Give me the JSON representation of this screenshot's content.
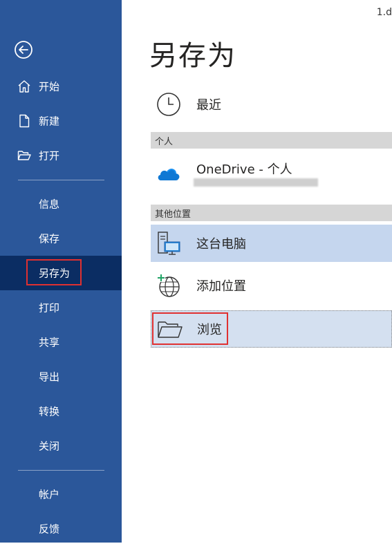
{
  "document": {
    "filename": "1.d"
  },
  "sidebar": {
    "back_icon": "back-arrow-icon",
    "top_items": [
      {
        "label": "开始",
        "icon": "home-icon"
      },
      {
        "label": "新建",
        "icon": "new-document-icon"
      },
      {
        "label": "打开",
        "icon": "open-folder-icon"
      }
    ],
    "middle_items": [
      {
        "label": "信息"
      },
      {
        "label": "保存"
      },
      {
        "label": "另存为",
        "selected": true
      },
      {
        "label": "打印"
      },
      {
        "label": "共享"
      },
      {
        "label": "导出"
      },
      {
        "label": "转换"
      },
      {
        "label": "关闭"
      }
    ],
    "bottom_items": [
      {
        "label": "帐户"
      },
      {
        "label": "反馈"
      }
    ]
  },
  "main": {
    "title": "另存为",
    "recent": {
      "label": "最近",
      "icon": "clock-icon"
    },
    "personal_header": "个人",
    "onedrive": {
      "label": "OneDrive - 个人",
      "icon": "onedrive-cloud-icon"
    },
    "other_header": "其他位置",
    "this_pc": {
      "label": "这台电脑",
      "icon": "computer-icon"
    },
    "add_place": {
      "label": "添加位置",
      "icon": "globe-add-icon"
    },
    "browse": {
      "label": "浏览",
      "icon": "folder-icon"
    }
  },
  "colors": {
    "sidebar_bg": "#2b579a",
    "selected_bg": "#0b2d63",
    "highlight_bg": "#c5d6ee",
    "annotation_red": "#e03030",
    "onedrive_blue": "#0f78d4"
  }
}
